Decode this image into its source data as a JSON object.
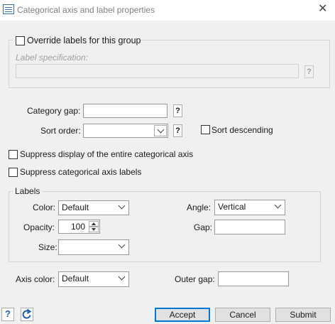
{
  "window": {
    "title": "Categorical axis and label properties",
    "icon": "dialog-icon",
    "close_icon": "close-icon"
  },
  "override_group": {
    "checkbox_label": "Override labels for this group",
    "checked": false,
    "label_spec_label": "Label specification:",
    "label_spec_value": "",
    "help": "?"
  },
  "category_gap": {
    "label": "Category gap:",
    "value": "",
    "help": "?"
  },
  "sort_order": {
    "label": "Sort order:",
    "value": "",
    "help": "?"
  },
  "sort_descending": {
    "label": "Sort descending",
    "checked": false
  },
  "suppress_axis": {
    "label": "Suppress display of the entire categorical axis",
    "checked": false
  },
  "suppress_labels": {
    "label": "Suppress categorical axis labels",
    "checked": false
  },
  "labels_group": {
    "title": "Labels",
    "color_label": "Color:",
    "color_value": "Default",
    "angle_label": "Angle:",
    "angle_value": "Vertical",
    "opacity_label": "Opacity:",
    "opacity_value": "100",
    "gap_label": "Gap:",
    "gap_value": "",
    "size_label": "Size:",
    "size_value": ""
  },
  "axis_color": {
    "label": "Axis color:",
    "value": "Default"
  },
  "outer_gap": {
    "label": "Outer gap:",
    "value": ""
  },
  "footer": {
    "help_icon": "help-icon",
    "reset_icon": "reset-icon",
    "accept": "Accept",
    "cancel": "Cancel",
    "submit": "Submit"
  },
  "colors": {
    "accent": "#0078d7",
    "help_blue": "#1a5fb4"
  }
}
